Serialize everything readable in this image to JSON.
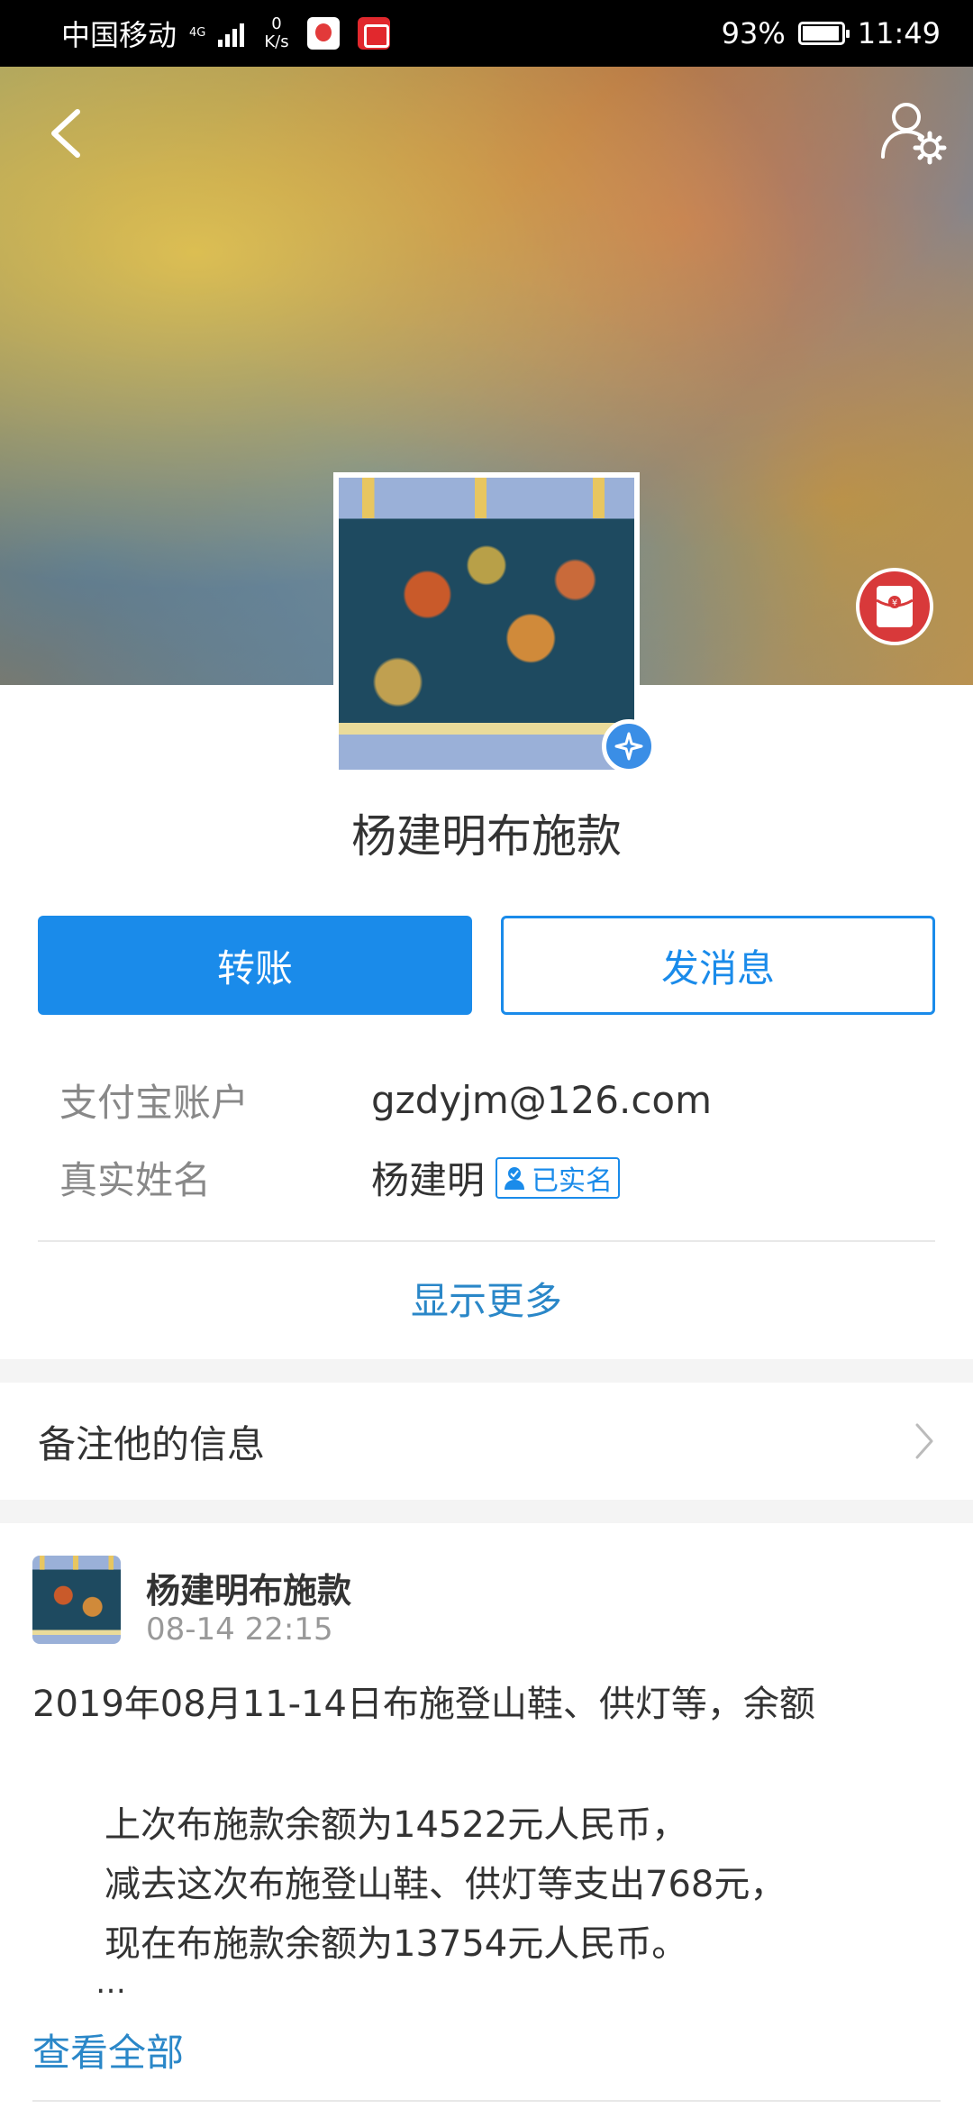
{
  "status_bar": {
    "carrier": "中国移动",
    "net_type": "4G",
    "speed_value": "0",
    "speed_unit": "K/s",
    "battery": "93%",
    "time": "11:49"
  },
  "header": {
    "back_icon": "chevron-left-icon",
    "settings_icon": "user-settings-icon",
    "redpacket_icon": "red-packet-icon"
  },
  "profile": {
    "name": "杨建明布施款",
    "transfer_label": "转账",
    "message_label": "发消息",
    "account_label": "支付宝账户",
    "account_value": "gzdyjm@126.com",
    "realname_label": "真实姓名",
    "realname_value": "杨建明",
    "verified_label": "已实名",
    "show_more": "显示更多"
  },
  "note": {
    "label": "备注他的信息"
  },
  "post": {
    "author": "杨建明布施款",
    "time": "08-14 22:15",
    "title": "2019年08月11-14日布施登山鞋、供灯等，余额",
    "lines": [
      "上次布施款余额为14522元人民币，",
      "减去这次布施登山鞋、供灯等支出768元，",
      "现在布施款余额为13754元人民币。"
    ],
    "ellipsis": "…",
    "view_all": "查看全部"
  },
  "colors": {
    "accent": "#1a8bea",
    "link": "#2a87c8",
    "red_packet": "#d8393a"
  }
}
